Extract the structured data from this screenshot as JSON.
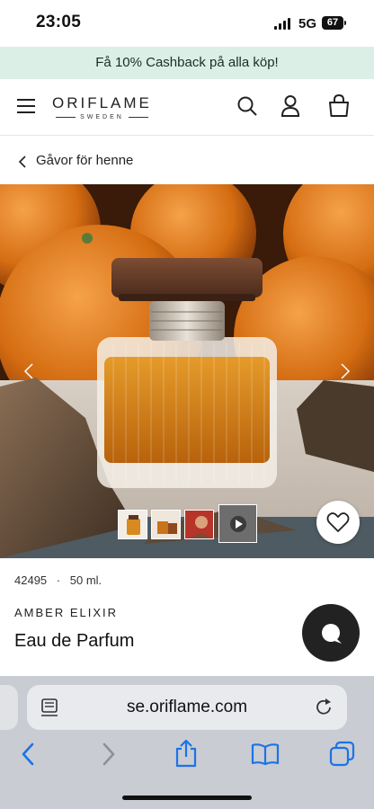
{
  "status_bar": {
    "time": "23:05",
    "network": "5G",
    "battery": "67"
  },
  "promo_banner": {
    "text": "Få 10% Cashback på alla köp!"
  },
  "header": {
    "logo_top": "ORIFLAME",
    "logo_bottom": "SWEDEN",
    "icons": [
      "menu-icon",
      "search-icon",
      "user-icon",
      "bag-icon"
    ]
  },
  "breadcrumb": {
    "label": "Gåvor för henne"
  },
  "gallery": {
    "thumbnail_count": 4
  },
  "product": {
    "code": "42495",
    "separator": "·",
    "size": "50 ml.",
    "brand": "AMBER ELIXIR",
    "name": "Eau de Parfum"
  },
  "browser": {
    "url": "se.oriflame.com"
  },
  "colors": {
    "banner_bg": "#dcefe7",
    "chrome_bg": "#c9ccd2",
    "ios_blue": "#1a73e8"
  }
}
